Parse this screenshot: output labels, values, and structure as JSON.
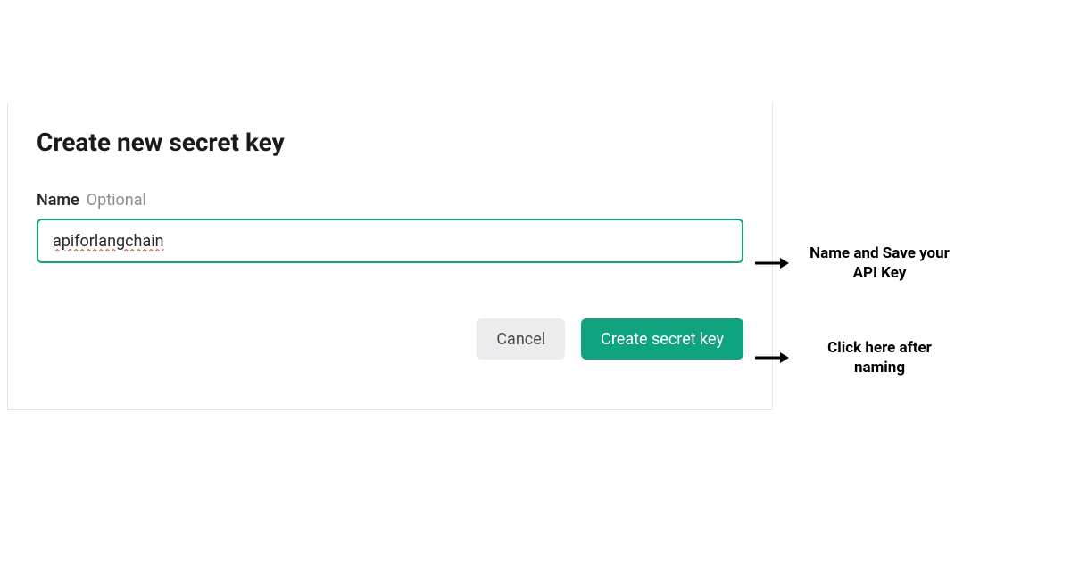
{
  "dialog": {
    "title": "Create new secret key",
    "nameLabel": "Name",
    "optionalLabel": "Optional",
    "nameValue": "apiforlangchain",
    "cancelLabel": "Cancel",
    "createLabel": "Create secret key"
  },
  "annotations": {
    "first": "Name and Save your API Key",
    "second": "Click here after naming"
  },
  "colors": {
    "accent": "#10a37f",
    "cancelBg": "#ececef"
  }
}
